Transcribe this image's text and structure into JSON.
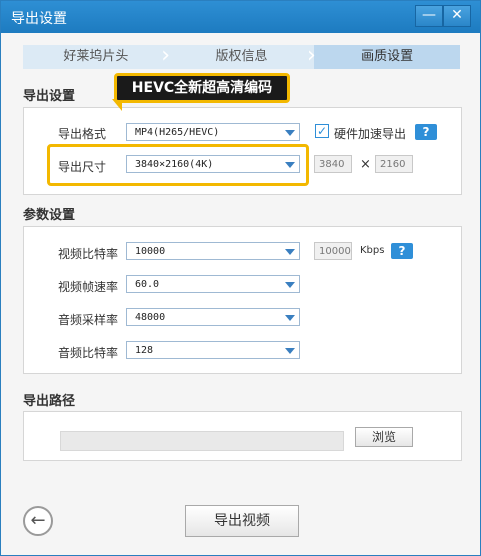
{
  "window": {
    "title": "导出设置",
    "minimize_icon": "minimize-icon",
    "close_icon": "close-icon"
  },
  "steps": [
    "好莱坞片头",
    "版权信息",
    "画质设置"
  ],
  "callout": "HEVC全新超高清编码",
  "export_settings": {
    "section_title": "导出设置",
    "format_label": "导出格式",
    "format_value": "MP4(H265/HEVC)",
    "hw_accel_label": "硬件加速导出",
    "hw_accel_checked": true,
    "help": "?",
    "size_label": "导出尺寸",
    "size_value": "3840×2160(4K)",
    "width": "3840",
    "x_sep": "×",
    "height": "2160"
  },
  "params": {
    "section_title": "参数设置",
    "video_bitrate_label": "视频比特率",
    "video_bitrate_value": "10000",
    "video_bitrate_field": "10000",
    "kbps": "Kbps",
    "help": "?",
    "framerate_label": "视频帧速率",
    "framerate_value": "60.0",
    "audio_samplerate_label": "音频采样率",
    "audio_samplerate_value": "48000",
    "audio_bitrate_label": "音频比特率",
    "audio_bitrate_value": "128"
  },
  "output_path": {
    "section_title": "导出路径",
    "path_value": "",
    "browse_label": "浏览"
  },
  "footer": {
    "export_button": "导出视频",
    "back_icon": "back-arrow-icon"
  },
  "colors": {
    "titlebar": "#1d7bc0",
    "highlight": "#f3b800",
    "accent": "#2f8fd8"
  }
}
